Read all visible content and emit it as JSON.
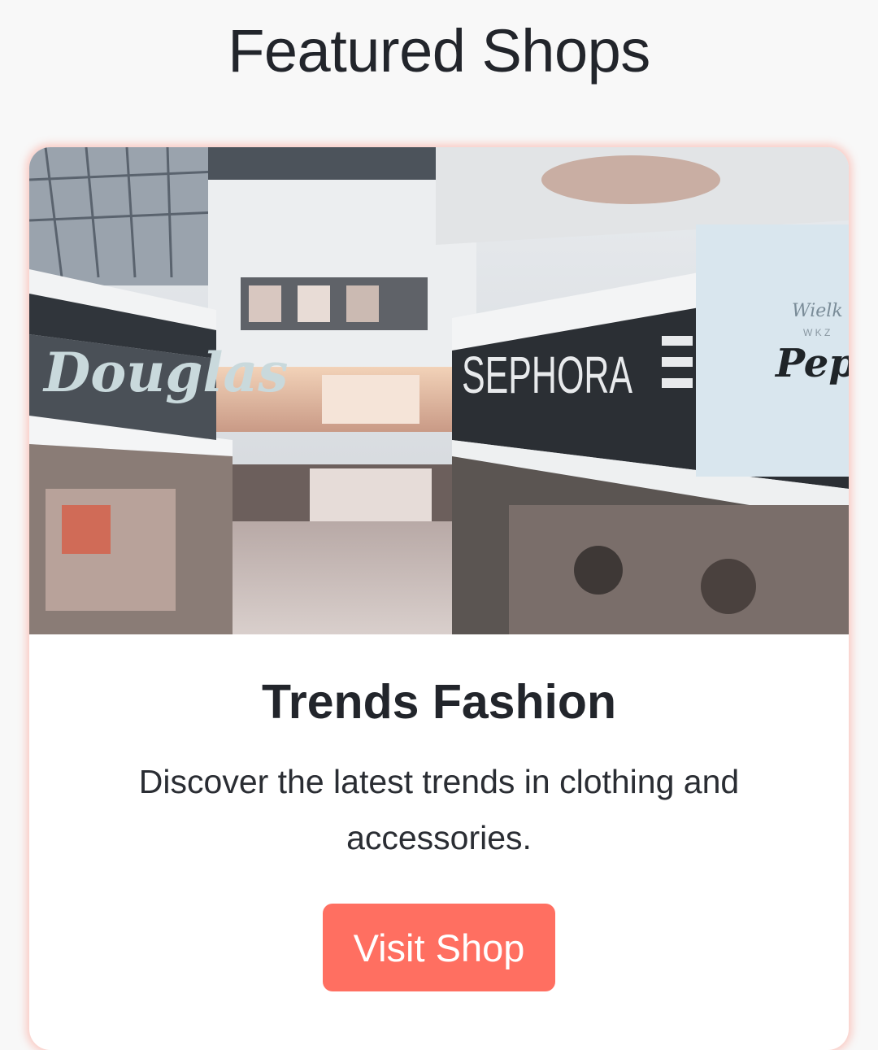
{
  "page": {
    "title": "Featured Shops"
  },
  "shop_card": {
    "image": {
      "signs": [
        "Douglas",
        "SEPHORA",
        "Wielk",
        "W K Z",
        "Pep"
      ]
    },
    "title": "Trends Fashion",
    "description": "Discover the latest trends in clothing and accessories.",
    "button_label": "Visit Shop"
  },
  "colors": {
    "background": "#f8f8f8",
    "card": "#ffffff",
    "accent": "#ff6f61",
    "text": "#22252b"
  }
}
